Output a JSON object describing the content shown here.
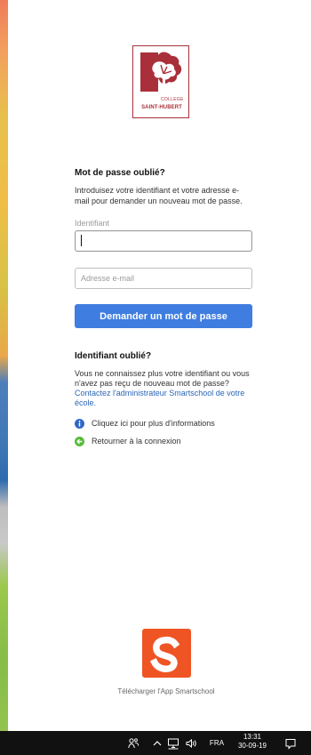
{
  "brand": {
    "logo_icon": "tree-crest-icon",
    "logo_line1": "COLLEGE",
    "logo_line2": "SAINT-HUBERT",
    "brand_red": "#a9303a"
  },
  "form": {
    "title": "Mot de passe oublié?",
    "description": "Introduisez votre identifiant et votre adresse e-mail pour demander un nouveau mot de passe.",
    "identifier_label": "Identifiant",
    "identifier_value": "",
    "email_value": "",
    "email_placeholder": "Adresse e-mail",
    "submit_label": "Demander un mot de passe",
    "submit_color": "#3f7de0"
  },
  "forgot_identifier": {
    "title": "Identifiant oublié?",
    "description": "Vous ne connaissez plus votre identifiant ou vous n'avez pas reçu de nouveau mot de passe?",
    "contact_link": "Contactez l'administrateur Smartschool de votre école."
  },
  "actions": [
    {
      "label": "Cliquez ici pour plus d'informations",
      "icon": "info-icon",
      "color": "#2f67c8"
    },
    {
      "label": "Retourner à la connexion",
      "icon": "arrow-left-icon",
      "color": "#58bb3a"
    }
  ],
  "app": {
    "icon": "smartschool-s-icon",
    "label": "Télécharger l'App Smartschool",
    "color": "#ef5424"
  },
  "taskbar": {
    "people_icon": "people-icon",
    "chevron_icon": "chevron-up-icon",
    "network_icon": "network-icon",
    "volume_icon": "volume-icon",
    "language": "FRA",
    "time": "13:31",
    "date": "30-09-19",
    "notification_icon": "notification-icon",
    "background": "#111111"
  }
}
